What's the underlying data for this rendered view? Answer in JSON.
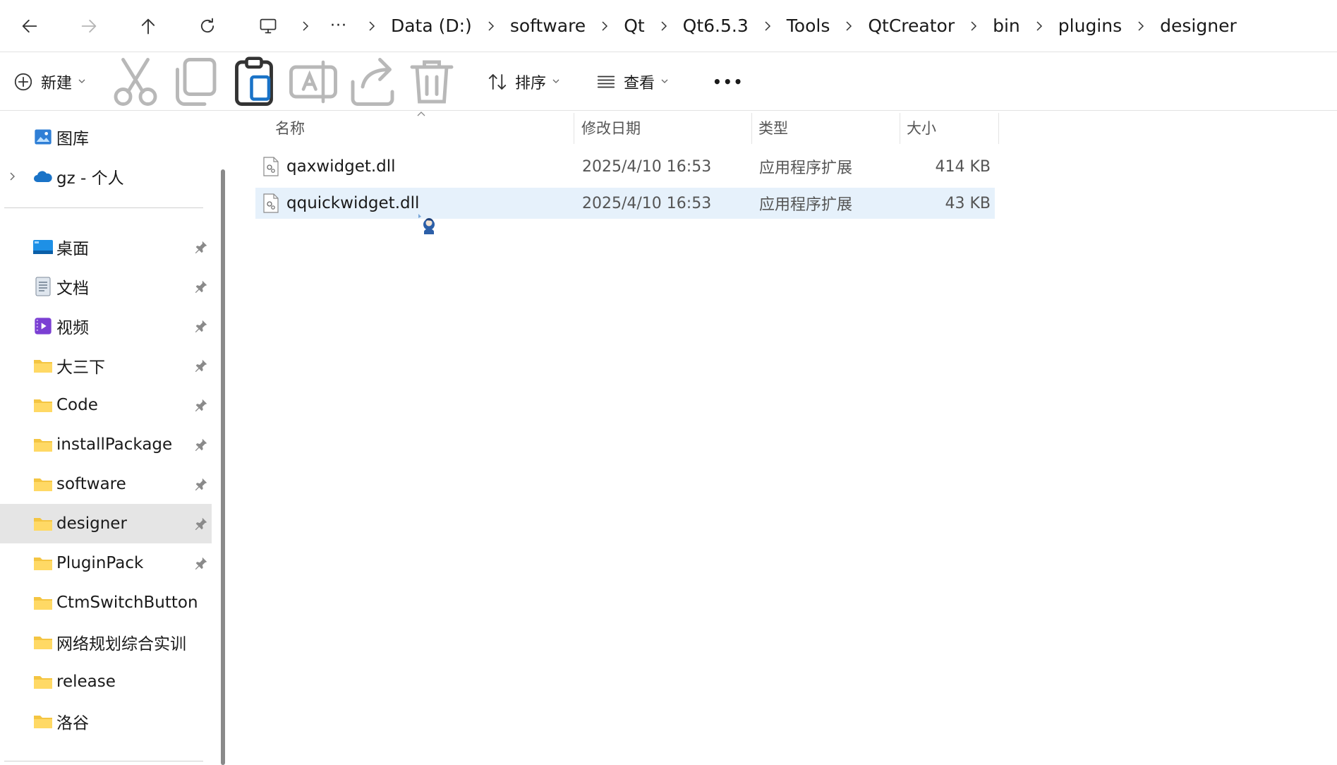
{
  "breadcrumb": {
    "more": "···",
    "segments": [
      "Data (D:)",
      "software",
      "Qt",
      "Qt6.5.3",
      "Tools",
      "QtCreator",
      "bin",
      "plugins",
      "designer"
    ]
  },
  "toolbar": {
    "new_label": "新建",
    "sort_label": "排序",
    "view_label": "查看",
    "more_label": "•••"
  },
  "sidebar": {
    "top_items": [
      {
        "label": "图库",
        "icon": "gallery-icon"
      },
      {
        "label": "gz - 个人",
        "icon": "onedrive-cloud-icon"
      }
    ],
    "pinned": [
      {
        "label": "桌面",
        "icon": "desktop-icon",
        "pinned": true
      },
      {
        "label": "文档",
        "icon": "documents-icon",
        "pinned": true
      },
      {
        "label": "视频",
        "icon": "videos-icon",
        "pinned": true
      },
      {
        "label": "大三下",
        "icon": "folder-icon",
        "pinned": true
      },
      {
        "label": "Code",
        "icon": "folder-icon",
        "pinned": true
      },
      {
        "label": "installPackage",
        "icon": "folder-icon",
        "pinned": true
      },
      {
        "label": "software",
        "icon": "folder-icon",
        "pinned": true
      },
      {
        "label": "designer",
        "icon": "folder-icon",
        "pinned": true,
        "selected": true
      },
      {
        "label": "PluginPack",
        "icon": "folder-icon",
        "pinned": true
      },
      {
        "label": "CtmSwitchButton",
        "icon": "folder-icon",
        "pinned": false
      },
      {
        "label": "网络规划综合实训",
        "icon": "folder-icon",
        "pinned": false
      },
      {
        "label": "release",
        "icon": "folder-icon",
        "pinned": false
      },
      {
        "label": "洛谷",
        "icon": "folder-icon",
        "pinned": false
      }
    ]
  },
  "columns": {
    "name": "名称",
    "modified": "修改日期",
    "type": "类型",
    "size": "大小"
  },
  "files": [
    {
      "name": "qaxwidget.dll",
      "modified": "2025/4/10 16:53",
      "type": "应用程序扩展",
      "size": "414 KB",
      "selected": false
    },
    {
      "name": "qquickwidget.dll",
      "modified": "2025/4/10 16:53",
      "type": "应用程序扩展",
      "size": "43 KB",
      "selected": true
    }
  ],
  "colors": {
    "selected_row": "#e6f1fb",
    "sidebar_selected": "#e5e5e5",
    "folder": "#f4c542",
    "accent": "#1a73c7"
  }
}
